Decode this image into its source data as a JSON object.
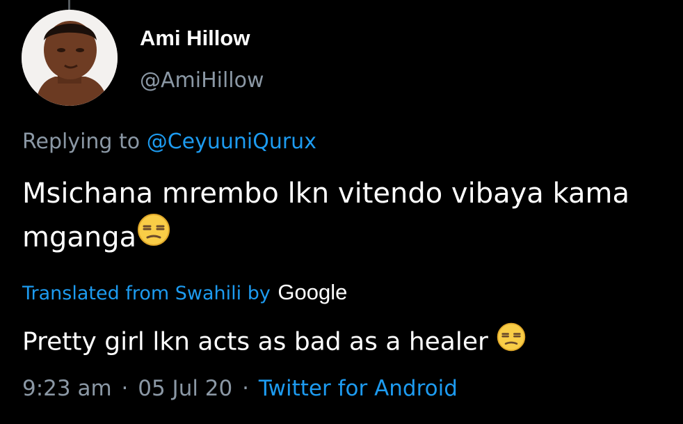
{
  "tweet": {
    "author": {
      "display_name": "Ami Hillow",
      "handle": "@AmiHillow"
    },
    "replying_to": {
      "prefix": "Replying to",
      "mention": "@CeyuuniQurux"
    },
    "text_lines": [
      "Msichana mrembo lkn vitendo vibaya kama",
      "mganga"
    ],
    "translation": {
      "label": "Translated from Swahili by",
      "provider": "Google",
      "text": "Pretty girl lkn acts as bad as a healer"
    },
    "time": "9:23 am",
    "separator": "·",
    "date": "05 Jul 20",
    "source": "Twitter for Android"
  },
  "colors": {
    "background": "#000000",
    "primary_text": "#ffffff",
    "secondary_text": "#8b98a5",
    "link": "#1d9bf0"
  },
  "icons": {
    "emoji": "unamused-face-emoji"
  }
}
